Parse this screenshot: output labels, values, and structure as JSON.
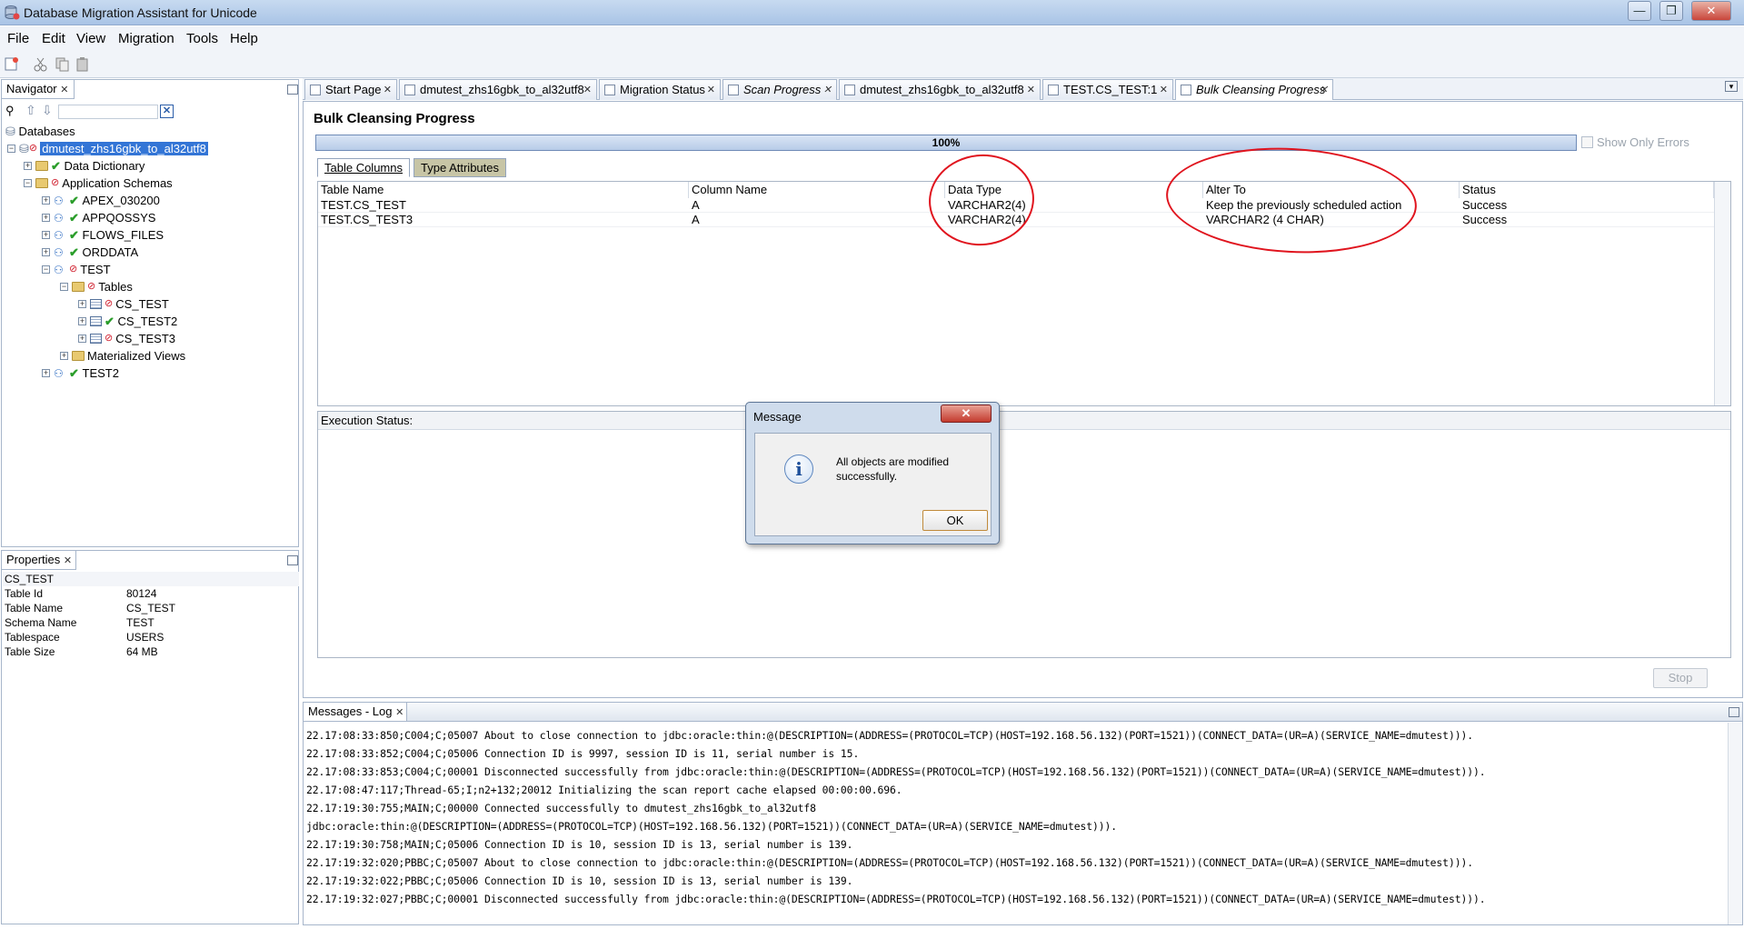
{
  "window": {
    "title": "Database Migration Assistant for Unicode",
    "minimize": "—",
    "restore": "❐",
    "close": "✕"
  },
  "menu": [
    "File",
    "Edit",
    "View",
    "Migration",
    "Tools",
    "Help"
  ],
  "navigator": {
    "title": "Navigator",
    "root": "Databases",
    "connection": "dmutest_zhs16gbk_to_al32utf8",
    "nodes": {
      "data_dictionary": "Data Dictionary",
      "application_schemas": "Application Schemas",
      "apex": "APEX_030200",
      "appqossys": "APPQOSSYS",
      "flows_files": "FLOWS_FILES",
      "orddata": "ORDDATA",
      "test": "TEST",
      "tables": "Tables",
      "cs_test": "CS_TEST",
      "cs_test2": "CS_TEST2",
      "cs_test3": "CS_TEST3",
      "materialized_views": "Materialized Views",
      "test2": "TEST2"
    }
  },
  "properties": {
    "title": "Properties",
    "object": "CS_TEST",
    "rows": [
      {
        "k": "Table Id",
        "v": "80124"
      },
      {
        "k": "Table Name",
        "v": "CS_TEST"
      },
      {
        "k": "Schema Name",
        "v": "TEST"
      },
      {
        "k": "Tablespace",
        "v": "USERS"
      },
      {
        "k": "Table Size",
        "v": "64 MB"
      }
    ]
  },
  "tabs": [
    {
      "label": "Start Page"
    },
    {
      "label": "dmutest_zhs16gbk_to_al32utf8"
    },
    {
      "label": "Migration Status"
    },
    {
      "label": "Scan Progress"
    },
    {
      "label": "dmutest_zhs16gbk_to_al32utf8"
    },
    {
      "label": "TEST.CS_TEST:1"
    },
    {
      "label": "Bulk Cleansing Progress"
    }
  ],
  "bulk": {
    "heading": "Bulk Cleansing Progress",
    "progress_label": "100%",
    "progress": 1.0,
    "show_only_errors": "Show Only Errors",
    "subtabs": [
      "Table Columns",
      "Type Attributes"
    ],
    "columns": [
      "Table Name",
      "Column Name",
      "Data Type",
      "Alter To",
      "Status"
    ],
    "rows": [
      [
        "TEST.CS_TEST",
        "A",
        "VARCHAR2(4)",
        "Keep the previously scheduled action",
        "Success"
      ],
      [
        "TEST.CS_TEST3",
        "A",
        "VARCHAR2(4)",
        "VARCHAR2 (4 CHAR)",
        "Success"
      ]
    ],
    "execution_status": "Execution Status:",
    "stop": "Stop"
  },
  "dialog": {
    "title": "Message",
    "text1": "All objects are modified",
    "text2": "successfully.",
    "ok": "OK",
    "close": "✕"
  },
  "log": {
    "title": "Messages - Log",
    "lines": [
      "22.17:08:33:850;C004;C;05007 About to close connection to jdbc:oracle:thin:@(DESCRIPTION=(ADDRESS=(PROTOCOL=TCP)(HOST=192.168.56.132)(PORT=1521))(CONNECT_DATA=(UR=A)(SERVICE_NAME=dmutest))).",
      "22.17:08:33:852;C004;C;05006 Connection ID is 9997, session ID is 11, serial number is 15.",
      "22.17:08:33:853;C004;C;00001 Disconnected successfully from jdbc:oracle:thin:@(DESCRIPTION=(ADDRESS=(PROTOCOL=TCP)(HOST=192.168.56.132)(PORT=1521))(CONNECT_DATA=(UR=A)(SERVICE_NAME=dmutest))).",
      "22.17:08:47:117;Thread-65;I;n2+132;20012 Initializing the scan report cache elapsed 00:00:00.696.",
      "22.17:19:30:755;MAIN;C;00000 Connected successfully to dmutest_zhs16gbk_to_al32utf8",
      "jdbc:oracle:thin:@(DESCRIPTION=(ADDRESS=(PROTOCOL=TCP)(HOST=192.168.56.132)(PORT=1521))(CONNECT_DATA=(UR=A)(SERVICE_NAME=dmutest))).",
      "22.17:19:30:758;MAIN;C;05006 Connection ID is 10, session ID is 13, serial number is 139.",
      "22.17:19:32:020;PBBC;C;05007 About to close connection to jdbc:oracle:thin:@(DESCRIPTION=(ADDRESS=(PROTOCOL=TCP)(HOST=192.168.56.132)(PORT=1521))(CONNECT_DATA=(UR=A)(SERVICE_NAME=dmutest))).",
      "22.17:19:32:022;PBBC;C;05006 Connection ID is 10, session ID is 13, serial number is 139.",
      "22.17:19:32:027;PBBC;C;00001 Disconnected successfully from jdbc:oracle:thin:@(DESCRIPTION=(ADDRESS=(PROTOCOL=TCP)(HOST=192.168.56.132)(PORT=1521))(CONNECT_DATA=(UR=A)(SERVICE_NAME=dmutest)))."
    ]
  },
  "colors": {
    "accent": "#3b6fb6",
    "annotation": "#e0141e",
    "selection": "#3375d6"
  }
}
